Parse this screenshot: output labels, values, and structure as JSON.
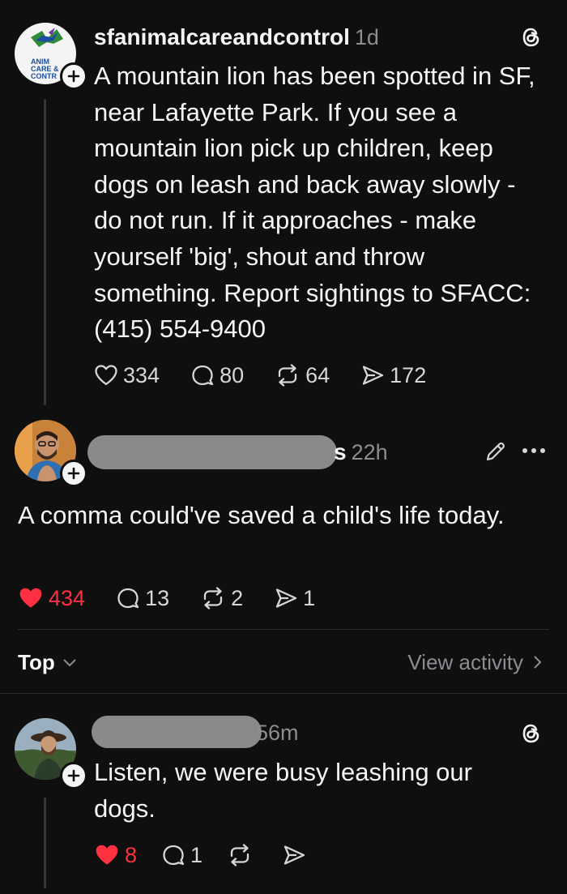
{
  "posts": [
    {
      "username": "sfanimalcareandcontrol",
      "time": "1d",
      "avatar_text": [
        "ANIM",
        "CARE &",
        "CONTR"
      ],
      "body": "A mountain lion has been spotted in SF, near Lafayette Park. If you see a mountain lion pick up children, keep dogs on leash and back away slowly - do not run. If it approaches - make yourself 'big', shout and throw something. Report sightings to SFACC: (415) 554-9400",
      "likes": "334",
      "replies": "80",
      "reposts": "64",
      "shares": "172"
    },
    {
      "username_suffix": "s",
      "time": "22h",
      "body": "A comma could've saved a child's life today.",
      "likes": "434",
      "replies": "13",
      "reposts": "2",
      "shares": "1"
    },
    {
      "time": "56m",
      "body": "Listen, we were busy leashing our dogs.",
      "likes": "8",
      "replies": "1"
    }
  ],
  "sort": {
    "label": "Top",
    "activity": "View activity"
  },
  "colors": {
    "background": "#0f0f0f",
    "text": "#f3f5f7",
    "muted": "#8a8d91",
    "like_red": "#ff3040"
  },
  "icons": [
    "heart-icon",
    "comment-icon",
    "repost-icon",
    "share-icon",
    "threads-logo-icon",
    "edit-icon",
    "more-icon",
    "chevron-down-icon",
    "chevron-right-icon",
    "plus-icon"
  ]
}
